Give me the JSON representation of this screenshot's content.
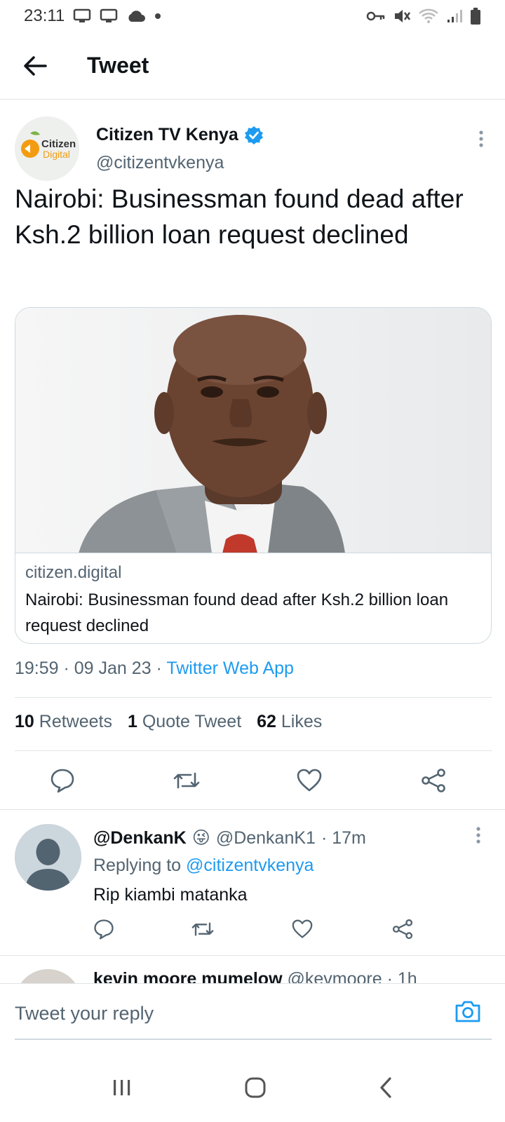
{
  "status_bar": {
    "time": "23:11"
  },
  "header": {
    "title": "Tweet"
  },
  "tweet": {
    "author_name": "Citizen TV Kenya",
    "author_handle": "@citizentvkenya",
    "avatar_text_1": "Citizen",
    "avatar_text_2": "Digital",
    "text": "Nairobi: Businessman found dead after Ksh.2 billion loan request declined",
    "card": {
      "domain": "citizen.digital",
      "title": "Nairobi: Businessman found dead after Ksh.2 billion loan request declined"
    },
    "timestamp": "19:59 · 09 Jan 23 · ",
    "source_app": "Twitter Web App",
    "stats": {
      "retweets_count": "10",
      "retweets_label": "Retweets",
      "quotes_count": "1",
      "quotes_label": "Quote Tweet",
      "likes_count": "62",
      "likes_label": "Likes"
    }
  },
  "reply": {
    "name": "@DenkanK",
    "emoji": "😜",
    "handle": "@DenkanK1",
    "time": "· 17m",
    "replying_prefix": "Replying to ",
    "replying_to": "@citizentvkenya",
    "text": "Rip kiambi matanka"
  },
  "next_reply": {
    "name": "kevin moore mumelow",
    "handle": "@kevmoore",
    "time": "· 1h"
  },
  "compose": {
    "placeholder": "Tweet your reply"
  },
  "colors": {
    "accent": "#1d9bf0",
    "text": "#0f1419",
    "secondary": "#536471",
    "divider": "#e1e4e6"
  }
}
